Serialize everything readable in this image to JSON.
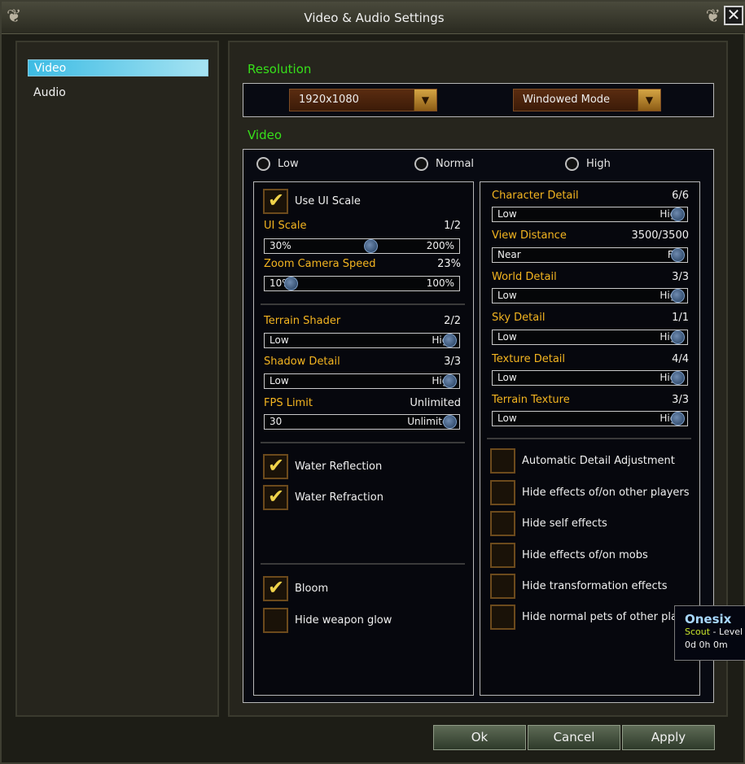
{
  "window": {
    "title": "Video & Audio Settings",
    "close_glyph": "✕"
  },
  "nav": {
    "items": [
      {
        "label": "Video",
        "active": true
      },
      {
        "label": "Audio",
        "active": false
      }
    ]
  },
  "resolution": {
    "title": "Resolution",
    "resolution_value": "1920x1080",
    "mode_value": "Windowed Mode"
  },
  "video": {
    "title": "Video",
    "presets": [
      "Low",
      "Normal",
      "High"
    ],
    "left": {
      "use_ui_scale": {
        "label": "Use UI Scale",
        "checked": true
      },
      "ui_scale": {
        "label": "UI Scale",
        "value": "1/2",
        "min": "30%",
        "max": "200%",
        "level": 0.5
      },
      "zoom_speed": {
        "label": "Zoom Camera Speed",
        "value": "23%",
        "min": "10%",
        "max": "100%",
        "level": 0.0
      },
      "terrain_shader": {
        "label": "Terrain Shader",
        "value": "2/2",
        "min": "Low",
        "max": "High",
        "level": 1.0
      },
      "shadow_detail": {
        "label": "Shadow Detail",
        "value": "3/3",
        "min": "Low",
        "max": "High",
        "level": 1.0
      },
      "fps_limit": {
        "label": "FPS Limit",
        "value": "Unlimited",
        "min": "30",
        "max": "Unlimited",
        "level": 1.0
      },
      "water_reflection": {
        "label": "Water Reflection",
        "checked": true
      },
      "water_refraction": {
        "label": "Water Refraction",
        "checked": true
      },
      "bloom": {
        "label": "Bloom",
        "checked": true
      },
      "hide_weapon_glow": {
        "label": "Hide weapon glow",
        "checked": false
      }
    },
    "right": {
      "character_detail": {
        "label": "Character Detail",
        "value": "6/6",
        "min": "Low",
        "max": "High",
        "level": 1.0
      },
      "view_distance": {
        "label": "View Distance",
        "value": "3500/3500",
        "min": "Near",
        "max": "Far",
        "level": 1.0
      },
      "world_detail": {
        "label": "World Detail",
        "value": "3/3",
        "min": "Low",
        "max": "High",
        "level": 1.0
      },
      "sky_detail": {
        "label": "Sky Detail",
        "value": "1/1",
        "min": "Low",
        "max": "High",
        "level": 1.0
      },
      "texture_detail": {
        "label": "Texture Detail",
        "value": "4/4",
        "min": "Low",
        "max": "High",
        "level": 1.0
      },
      "terrain_texture": {
        "label": "Terrain Texture",
        "value": "3/3",
        "min": "Low",
        "max": "High",
        "level": 1.0
      },
      "auto_detail": {
        "label": "Automatic Detail Adjustment",
        "checked": false
      },
      "hide_effects_players": {
        "label": "Hide effects of/on other players",
        "checked": false
      },
      "hide_self_effects": {
        "label": "Hide self effects",
        "checked": false
      },
      "hide_effects_mobs": {
        "label": "Hide effects of/on mobs",
        "checked": false
      },
      "hide_transformation": {
        "label": "Hide transformation effects",
        "checked": false
      },
      "hide_pets": {
        "label": "Hide normal pets of other players",
        "checked": false
      }
    }
  },
  "buttons": {
    "ok": "Ok",
    "cancel": "Cancel",
    "apply": "Apply"
  },
  "tooltip": {
    "name": "Onesix",
    "class": "Scout",
    "level": "- Level",
    "time": "0d 0h 0m"
  },
  "colors": {
    "section_title": "#37e01a",
    "label": "#f4b520",
    "nav_active": "#3dbce4"
  }
}
